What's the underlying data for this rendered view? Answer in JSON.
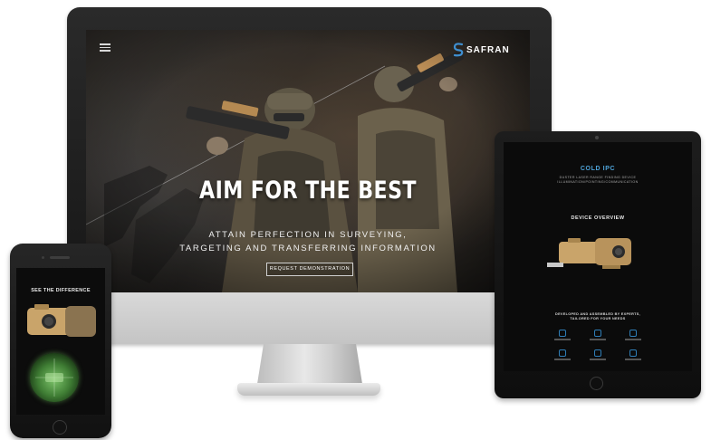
{
  "desktop": {
    "menu_icon": "hamburger-menu-icon",
    "brand": "SAFRAN",
    "hero_title": "AIM FOR THE BEST",
    "hero_subtitle_line1": "ATTAIN PERFECTION IN SURVEYING,",
    "hero_subtitle_line2": "TARGETING AND TRANSFERRING INFORMATION",
    "cta_label": "REQUEST DEMONSTRATION"
  },
  "tablet": {
    "title": "COLD IPC",
    "intro_line1": "DUSTER LASER RANGE FINDING DEVICE",
    "intro_line2": "ILLUMINATION/POINTING/COMMUNICATION",
    "device_overview": "DEVICE OVERVIEW",
    "section_heading_line1": "DEVELOPED AND ASSEMBLED BY EXPERTS,",
    "section_heading_line2": "TAILORED FOR YOUR NEEDS"
  },
  "phone": {
    "title": "SEE THE DIFFERENCE"
  },
  "colors": {
    "accent_blue": "#4ea3d8",
    "device_tan": "#c9a46a",
    "night_vision_green": "#6fbf5a"
  }
}
